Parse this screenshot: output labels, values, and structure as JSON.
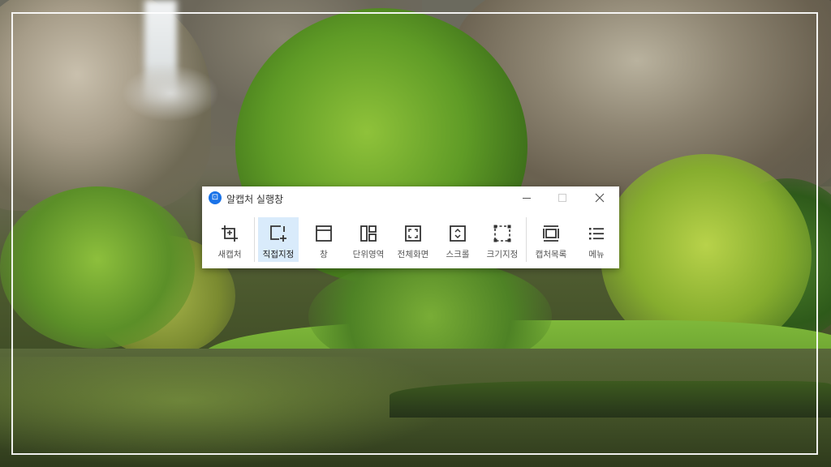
{
  "window": {
    "title": "알캡처 실행창",
    "app_icon_glyph": "⊡",
    "controls": {
      "minimize": "minimize-icon",
      "maximize": "maximize-icon",
      "close": "close-icon"
    }
  },
  "toolbar": {
    "items": [
      {
        "label": "새캡처",
        "icon": "crop-icon",
        "active": false
      },
      {
        "label": "직접지정",
        "icon": "select-region-icon",
        "active": true
      },
      {
        "label": "창",
        "icon": "window-icon",
        "active": false
      },
      {
        "label": "단위영역",
        "icon": "unit-region-icon",
        "active": false
      },
      {
        "label": "전체화면",
        "icon": "fullscreen-icon",
        "active": false
      },
      {
        "label": "스크롤",
        "icon": "scroll-icon",
        "active": false
      },
      {
        "label": "크기지정",
        "icon": "fixed-size-icon",
        "active": false
      },
      {
        "label": "캡처목록",
        "icon": "capture-list-icon",
        "active": false
      },
      {
        "label": "메뉴",
        "icon": "menu-icon",
        "active": false
      }
    ]
  },
  "colors": {
    "accent": "#1a73e8",
    "active_bg": "#d9ebfb",
    "icon": "#333333"
  }
}
